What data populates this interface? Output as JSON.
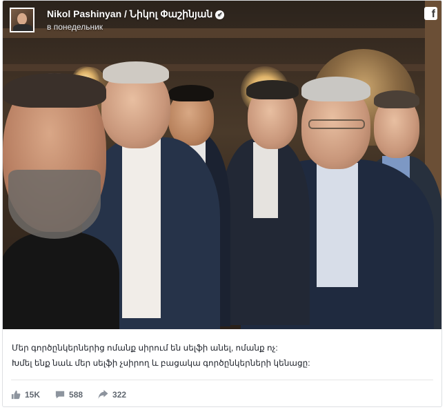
{
  "post": {
    "author": "Nikol Pashinyan / Նիկոլ Փաշինյան",
    "timestamp": "в понедельник",
    "icons": {
      "verified": "verified-badge-icon",
      "platform": "facebook-logo-icon"
    },
    "text_lines": [
      "Մեր գործընկերներից ոմանք սիրում են սելֆի անել, ոմանք ոչ:",
      "Խմել ենք նաև մեր սելֆի չսիրող և բացակա գործընկերների կենացը:"
    ]
  },
  "stats": {
    "likes": "15K",
    "comments": "588",
    "shares": "322"
  }
}
